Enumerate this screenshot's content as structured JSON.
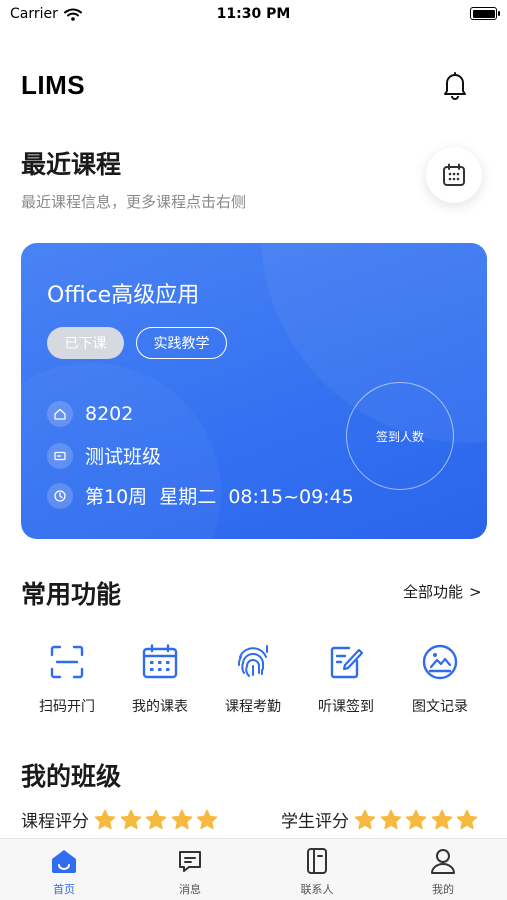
{
  "status_bar": {
    "carrier": "Carrier",
    "time": "11:30 PM"
  },
  "header": {
    "title": "LIMS"
  },
  "recent": {
    "title": "最近课程",
    "subtitle": "最近课程信息，更多课程点击右侧"
  },
  "course": {
    "name": "Office高级应用",
    "status_tag": "已下课",
    "type_tag": "实践教学",
    "room": "8202",
    "class_name": "测试班级",
    "schedule": "第10周  星期二  08:15~09:45",
    "signin_label": "签到人数"
  },
  "features": {
    "title": "常用功能",
    "all_label": "全部功能",
    "all_arrow": ">",
    "items": [
      {
        "label": "扫码开门",
        "icon": "scan-icon"
      },
      {
        "label": "我的课表",
        "icon": "calendar-icon"
      },
      {
        "label": "课程考勤",
        "icon": "fingerprint-icon"
      },
      {
        "label": "听课签到",
        "icon": "sign-edit-icon"
      },
      {
        "label": "图文记录",
        "icon": "image-record-icon"
      }
    ]
  },
  "my_class": {
    "title": "我的班级",
    "course_rating": {
      "label": "课程评分",
      "stars": 5
    },
    "student_rating": {
      "label": "学生评分",
      "stars": 5
    }
  },
  "tabs": [
    {
      "label": "首页",
      "icon": "home-icon",
      "active": true
    },
    {
      "label": "消息",
      "icon": "message-icon",
      "active": false
    },
    {
      "label": "联系人",
      "icon": "contacts-icon",
      "active": false
    },
    {
      "label": "我的",
      "icon": "profile-icon",
      "active": false
    }
  ],
  "colors": {
    "accent": "#2f6cf0",
    "star": "#f6b940",
    "card": "#3472f1"
  }
}
